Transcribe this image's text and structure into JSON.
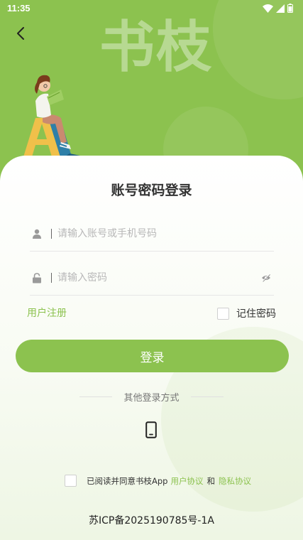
{
  "status_bar": {
    "time": "11:35"
  },
  "header": {
    "brand_title": "书枝"
  },
  "login": {
    "title": "账号密码登录",
    "account_placeholder": "请输入账号或手机号码",
    "password_placeholder": "请输入密码",
    "register_label": "用户注册",
    "remember_label": "记住密码",
    "remember_checked": false,
    "submit_label": "登录",
    "other_methods_label": "其他登录方式"
  },
  "agreement": {
    "prefix": "已阅读并同意书枝App",
    "user_agreement": "用户协议",
    "conjunction": "和",
    "privacy_policy": "隐私协议",
    "checked": false
  },
  "footer": {
    "icp": "苏ICP备2025190785号-1A"
  },
  "colors": {
    "brand_green": "#8cc24f",
    "card_bg": "#ffffff",
    "text_dark": "#333333",
    "placeholder": "#b8b8b8"
  },
  "icons": {
    "back": "chevron-left-icon",
    "account": "user-icon",
    "password": "lock-icon",
    "visibility": "eye-off-icon",
    "phone_login": "phone-icon",
    "wifi": "wifi-icon",
    "signal": "signal-icon",
    "battery": "battery-icon"
  }
}
